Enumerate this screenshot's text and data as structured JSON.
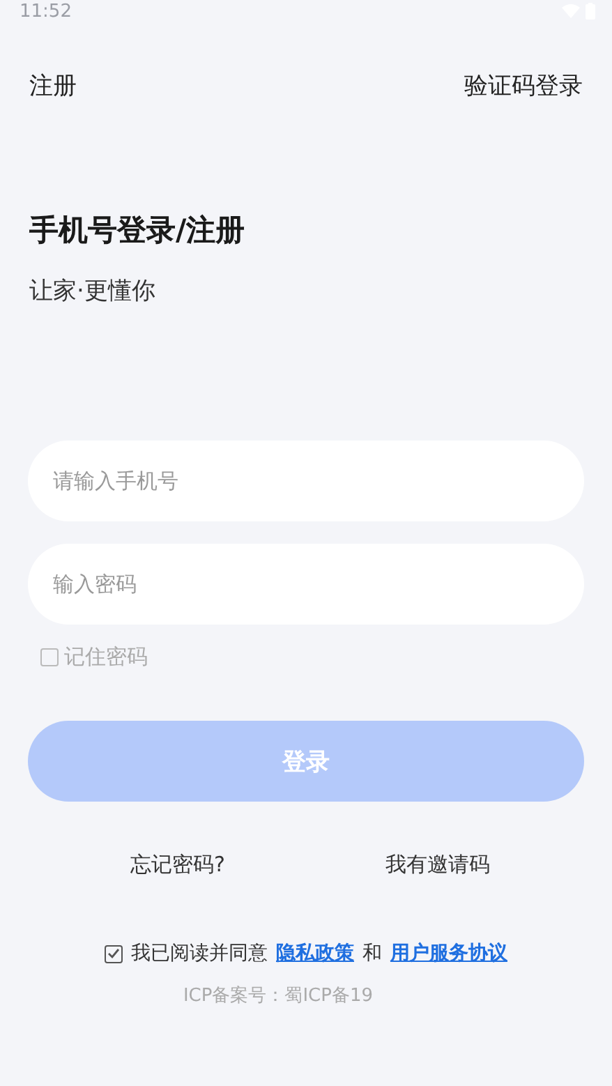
{
  "status_bar": {
    "time": "11:52"
  },
  "header": {
    "left": "注册",
    "right": "验证码登录"
  },
  "title": "手机号登录/注册",
  "subtitle": "让家·更懂你",
  "fields": [
    {
      "placeholder": "请输入手机号"
    },
    {
      "placeholder": "输入密码"
    }
  ],
  "remember": {
    "label": "记住密码",
    "checked": false
  },
  "login_button": {
    "label": "登录",
    "disabled": true
  },
  "links": [
    "忘记密码?",
    "我有邀请码"
  ],
  "agreement": {
    "checked": true,
    "text": "我已阅读并同意",
    "privacy": "隐私政策",
    "and": "和",
    "terms": "用户服务协议"
  },
  "icp": "ICP备案号：蜀ICP备19"
}
